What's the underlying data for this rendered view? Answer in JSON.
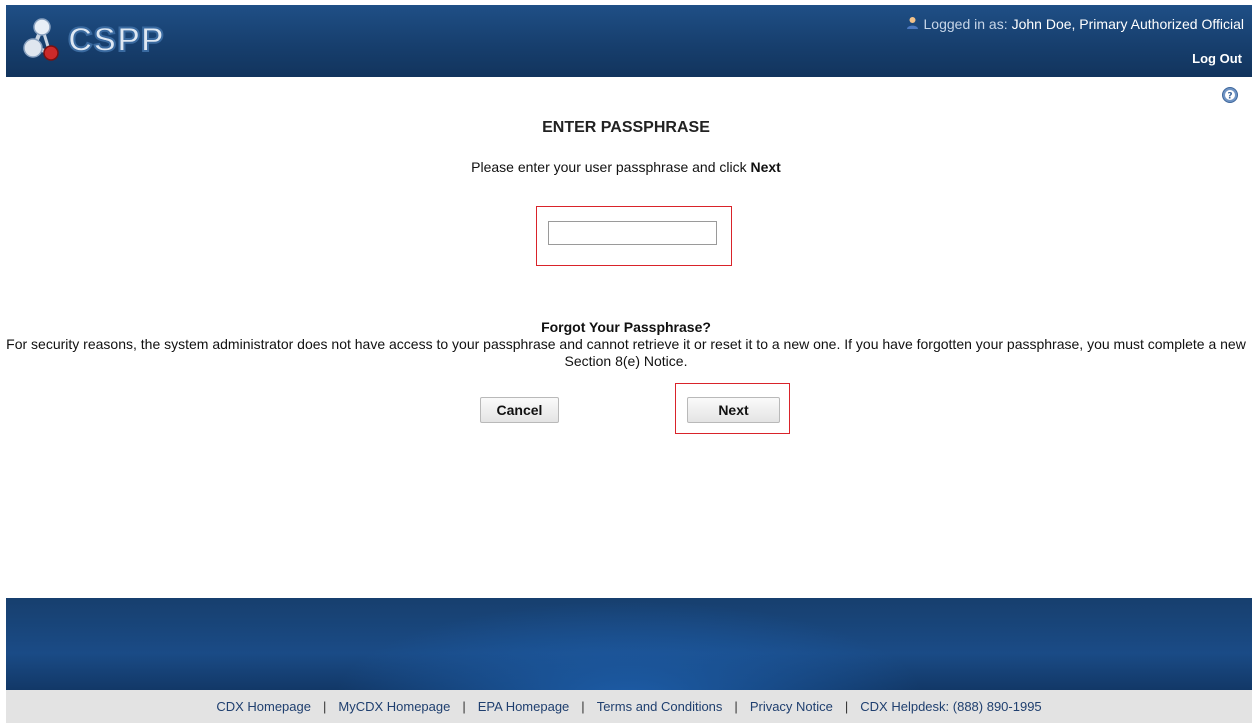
{
  "header": {
    "logo_text": "CSPP",
    "logged_in_label": "Logged in as:",
    "user": "John Doe, Primary Authorized Official",
    "logout_label": "Log Out"
  },
  "page": {
    "title": "ENTER PASSPHRASE",
    "instruction_prefix": "Please enter your user passphrase and click",
    "instruction_bold": "Next",
    "passphrase_value": ""
  },
  "forgot": {
    "title": "Forgot Your Passphrase?",
    "text": "For security reasons, the system administrator does not have access to your passphrase and cannot retrieve it or reset it to a new one. If you have forgotten your passphrase, you must complete a new Section 8(e) Notice."
  },
  "buttons": {
    "cancel": "Cancel",
    "next": "Next"
  },
  "footer": {
    "links": [
      {
        "label": "CDX Homepage"
      },
      {
        "label": "MyCDX Homepage"
      },
      {
        "label": "EPA Homepage"
      },
      {
        "label": "Terms and Conditions"
      },
      {
        "label": "Privacy Notice"
      },
      {
        "label": "CDX Helpdesk: (888) 890-1995"
      }
    ],
    "separator": "|"
  },
  "colors": {
    "header": "#1f4f86",
    "highlight": "#d9232a",
    "footer_bar": "#e3e3e3"
  }
}
